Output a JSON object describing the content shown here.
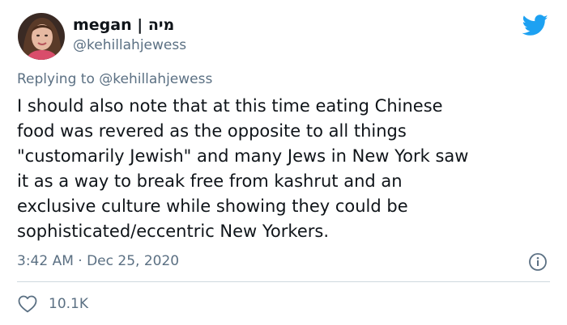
{
  "author": {
    "display_name": "megan | מיה",
    "handle": "@kehillahjewess",
    "avatar_icon": "profile-photo"
  },
  "reply": {
    "prefix": "Replying to ",
    "mention": "@kehillahjewess"
  },
  "body": {
    "lines": [
      "I should also note that at this time eating Chinese",
      "food was revered as the opposite to all things",
      "\"customarily Jewish\" and many Jews in New York saw",
      "it as a way to break free from kashrut and an",
      "exclusive culture while showing they could be",
      "sophisticated/eccentric New Yorkers."
    ]
  },
  "meta": {
    "timestamp": "3:42 AM · Dec 25, 2020",
    "likes": "10.1K"
  },
  "icons": {
    "brand": "twitter-bird-icon",
    "info": "info-icon",
    "like": "heart-icon"
  },
  "colors": {
    "brand": "#1da1f2",
    "text": "#0f1419",
    "secondary": "#5b7083",
    "divider": "#cfd9de"
  }
}
